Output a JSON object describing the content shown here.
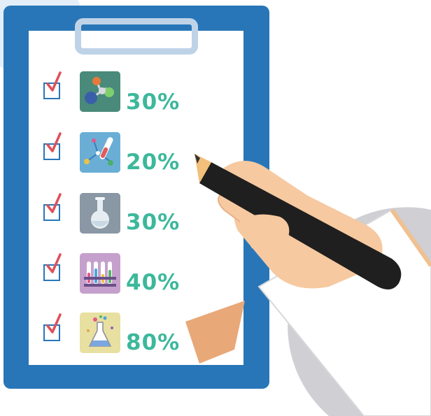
{
  "items": [
    {
      "percent": "30%",
      "icon": "molecule-icon",
      "tile_color": "#4a8a7a"
    },
    {
      "percent": "20%",
      "icon": "test-tube-network-icon",
      "tile_color": "#6aaed6"
    },
    {
      "percent": "30%",
      "icon": "flask-icon",
      "tile_color": "#8a97a4"
    },
    {
      "percent": "40%",
      "icon": "test-tube-rack-icon",
      "tile_color": "#c6a0cc"
    },
    {
      "percent": "80%",
      "icon": "erlenmeyer-flask-icon",
      "tile_color": "#e7e0a0"
    }
  ],
  "colors": {
    "board": "#2876b8",
    "percent_text": "#3cb89b",
    "check": "#e0505a"
  }
}
